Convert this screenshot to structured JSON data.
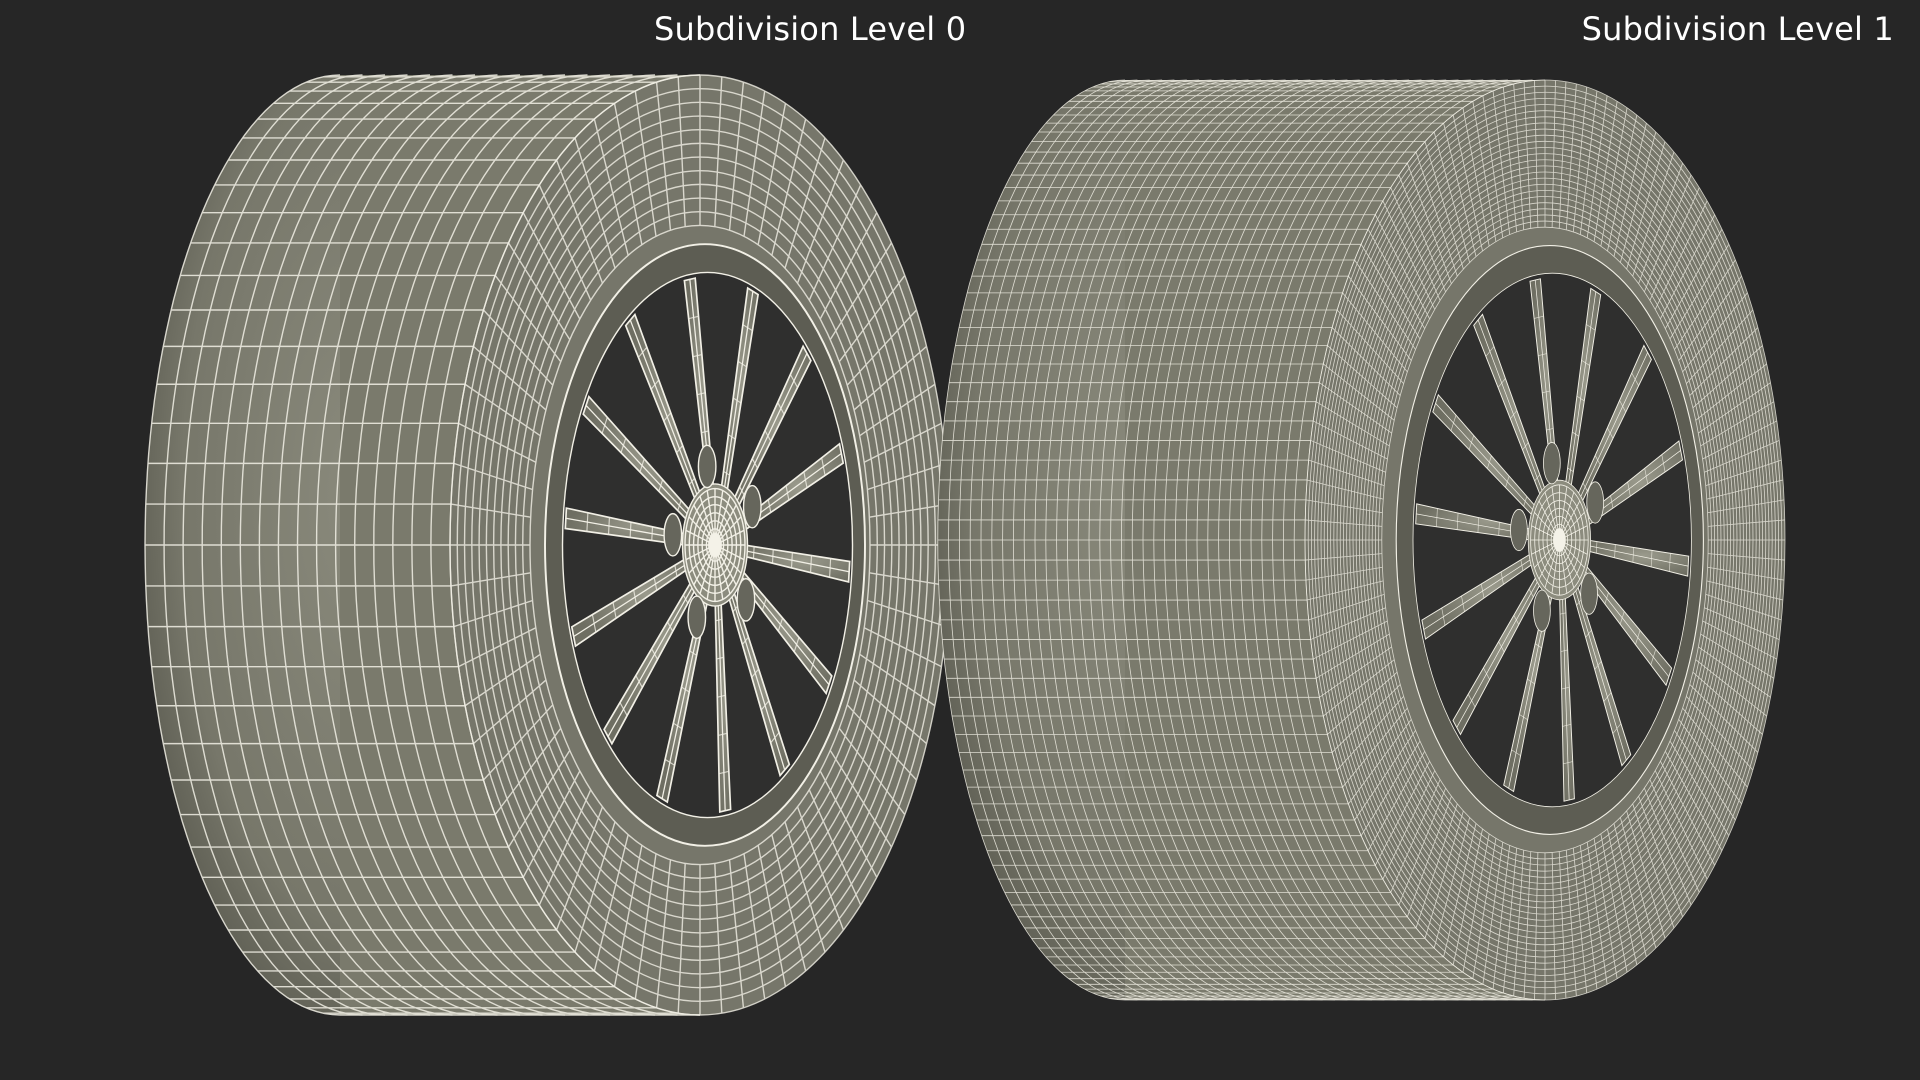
{
  "labels": {
    "left": "Subdivision Level 0",
    "right": "Subdivision Level 1"
  },
  "models": {
    "left": {
      "subdivision_level": 0
    },
    "right": {
      "subdivision_level": 1
    }
  },
  "colors": {
    "background": "#262626",
    "tire": "#7a7a6c",
    "tire_shadow": "#4e4e44",
    "rim": "#86867a",
    "wire": "#f2f0e6",
    "hole": "#2f2f2e"
  }
}
